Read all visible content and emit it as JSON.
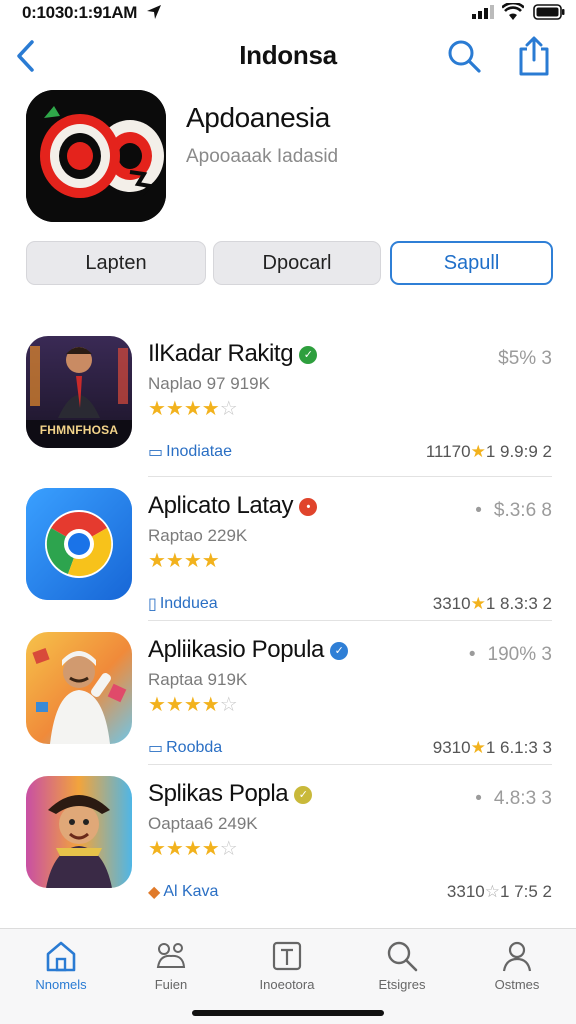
{
  "status": {
    "time": "0:1030:1:91AM"
  },
  "nav": {
    "title": "Indonsa"
  },
  "header": {
    "app_name": "Apdoanesia",
    "subtitle": "Apooaaak Iadasid"
  },
  "segments": [
    "Lapten",
    "Dpocarl",
    "Sapull"
  ],
  "apps": [
    {
      "name": "IlKadar Rakitg",
      "meta": "Naplao 97 919K",
      "stars": 4,
      "tag": "Inodiatae",
      "price": "$5% 3",
      "rating_count": "11170",
      "rating_value": "1 9.9:9 2",
      "badge_color": "#2e9f3e",
      "icon_label": "FHMNFHOSA"
    },
    {
      "name": "Aplicato Latay",
      "meta": "Raptao 229K",
      "stars": 4,
      "tag": "Indduea",
      "price": "$.3:6 8",
      "rating_count": "3310",
      "rating_value": "1 8.3:3 2",
      "badge_color": "#e0442c"
    },
    {
      "name": "Apliikasio Popula",
      "meta": "Raptaa 919K",
      "stars": 4,
      "tag": "Roobda",
      "price": "190% 3",
      "rating_count": "9310",
      "rating_value": "1 6.1:3 3",
      "badge_color": "#2f7fd6"
    },
    {
      "name": "Splikas Popla",
      "meta": "Oaptaa6 249K",
      "stars": 4,
      "tag": "Al Kava",
      "price": "4.8:3 3",
      "rating_count": "3310",
      "rating_value": "1 7:5 2",
      "badge_color": "#c9b93a"
    }
  ],
  "tabs": [
    "Nnomels",
    "Fuien",
    "Inoeotora",
    "Etsigres",
    "Ostmes"
  ],
  "colors": {
    "accent": "#2a7bd3",
    "star": "#f2b21d"
  }
}
